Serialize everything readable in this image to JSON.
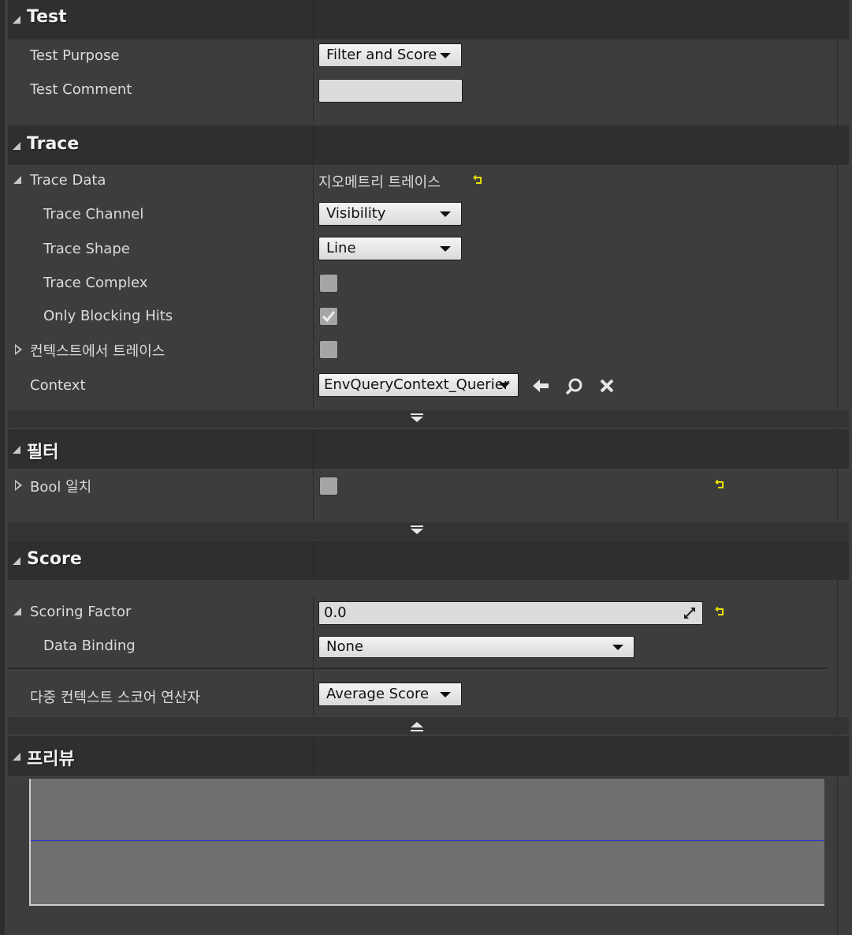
{
  "sections": {
    "test": {
      "title": "Test",
      "test_purpose_label": "Test Purpose",
      "test_purpose_value": "Filter and Score",
      "test_comment_label": "Test Comment",
      "test_comment_value": ""
    },
    "trace": {
      "title": "Trace",
      "trace_data_label": "Trace Data",
      "trace_data_value": "지오메트리 트레이스",
      "trace_channel_label": "Trace Channel",
      "trace_channel_value": "Visibility",
      "trace_shape_label": "Trace Shape",
      "trace_shape_value": "Line",
      "trace_complex_label": "Trace Complex",
      "trace_complex_checked": false,
      "only_blocking_hits_label": "Only Blocking Hits",
      "only_blocking_hits_checked": true,
      "trace_from_context_label": "컨텍스트에서 트레이스",
      "trace_from_context_checked": false,
      "context_label": "Context",
      "context_value": "EnvQueryContext_Querier"
    },
    "filter": {
      "title": "필터",
      "bool_match_label": "Bool 일치",
      "bool_match_checked": false
    },
    "score": {
      "title": "Score",
      "scoring_factor_label": "Scoring Factor",
      "scoring_factor_value": "0.0",
      "data_binding_label": "Data Binding",
      "data_binding_value": "None",
      "multi_context_label": "다중 컨텍스트 스코어 연산자",
      "multi_context_value": "Average Score"
    },
    "preview": {
      "title": "프리뷰"
    }
  },
  "icons": {
    "reset": "reset-to-default-icon",
    "use_selected": "arrow-left-icon",
    "browse": "search-icon",
    "clear": "close-icon"
  },
  "colors": {
    "background": "#3d3d3d",
    "header": "#2f2f2f",
    "reset_icon": "#e8e000",
    "preview_bg": "#6f6f6f",
    "preview_line": "#2828c8"
  }
}
